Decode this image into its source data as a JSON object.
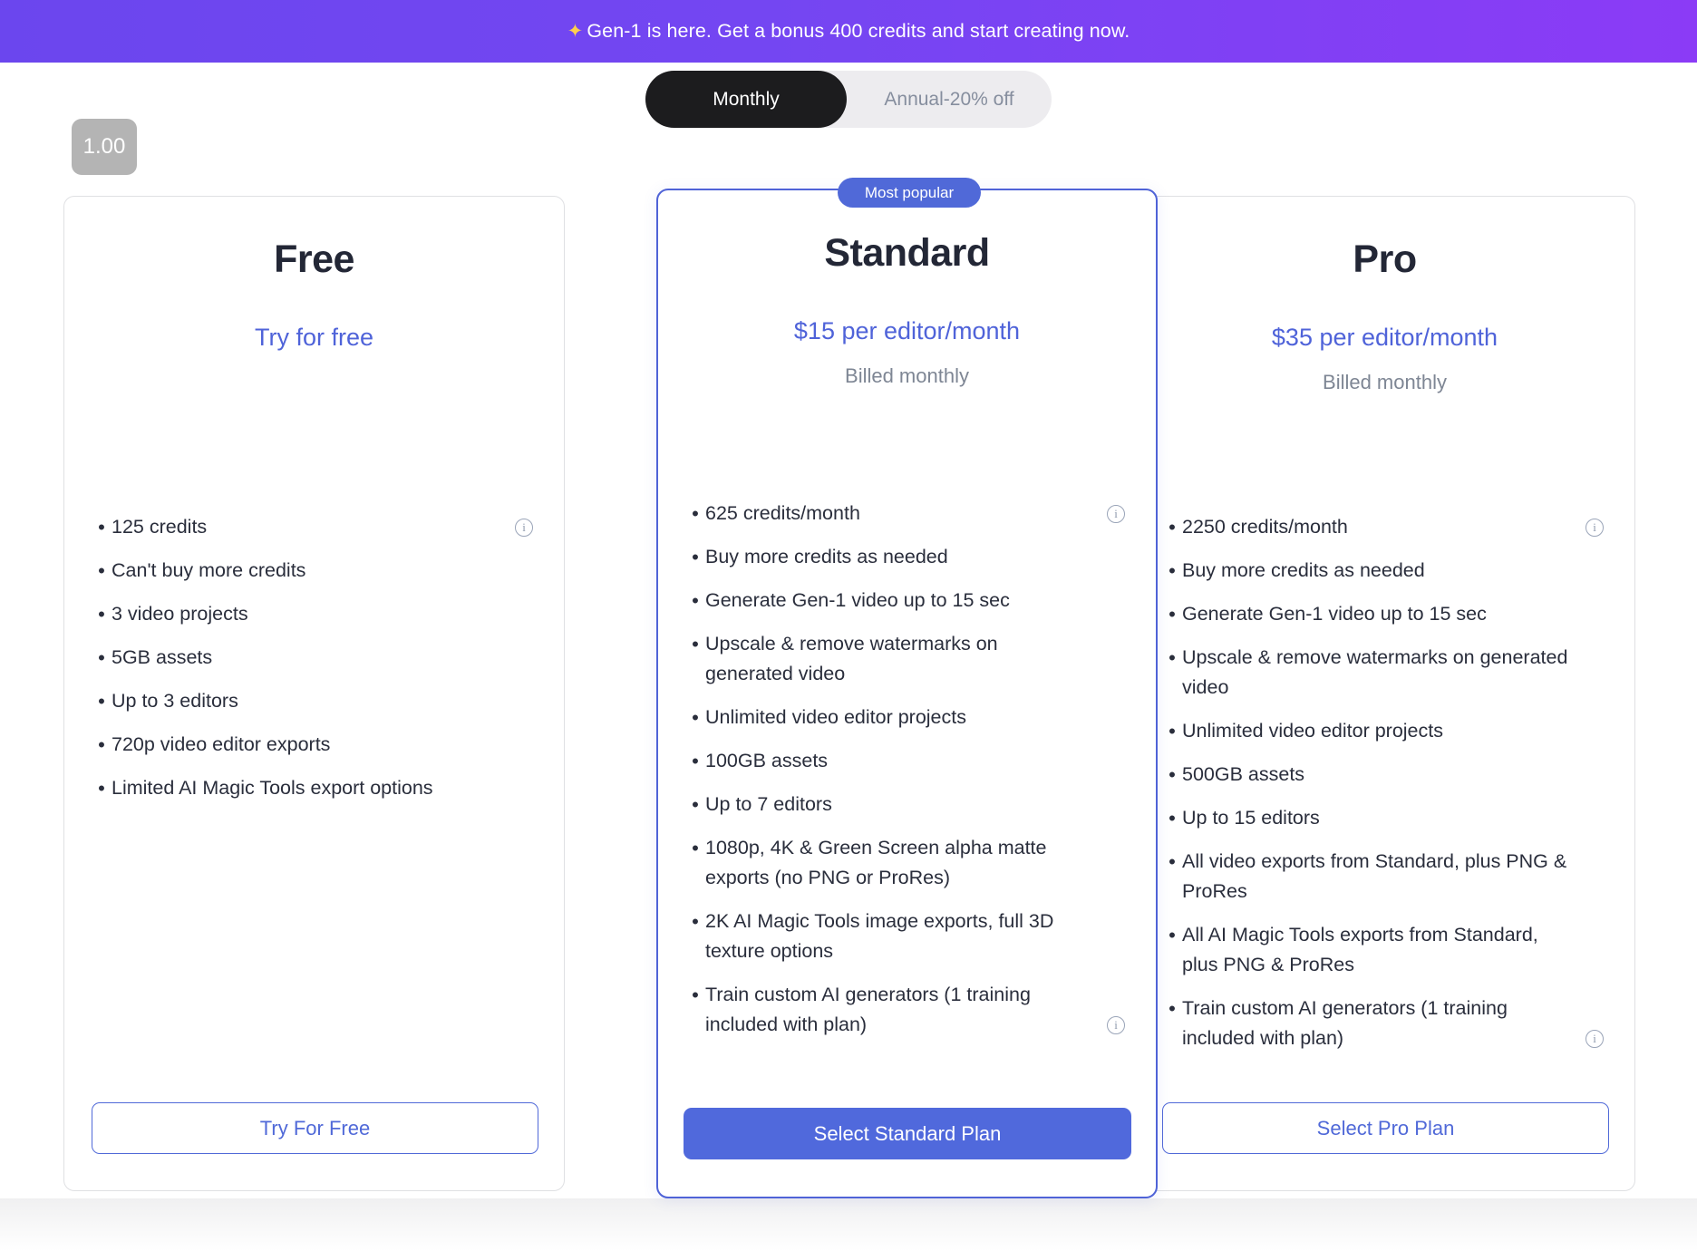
{
  "banner": {
    "icon": "sparkles-icon",
    "icon_glyph": "✦",
    "text": "Gen-1 is here. Get a bonus 400 credits and start creating now.",
    "gradient_from": "#6b46ee",
    "gradient_to": "#8b3bf6"
  },
  "billing_toggle": {
    "options": [
      {
        "label": "Monthly",
        "selected": true
      },
      {
        "label": "Annual-20% off",
        "selected": false
      }
    ],
    "active_bg": "#1c1c1e",
    "track_bg": "#edecef"
  },
  "zoom_indicator": {
    "value": "1.00"
  },
  "accent": {
    "blue": "#5069d8",
    "badge_blue": "#5069d8",
    "text_dark": "#232736",
    "muted": "#7e8694"
  },
  "plans": [
    {
      "name": "Free",
      "price": "Try for free",
      "billing": "",
      "badge": "",
      "highlighted": false,
      "features": [
        {
          "text": "125 credits",
          "info": true
        },
        {
          "text": "Can't buy more credits",
          "info": false
        },
        {
          "text": "3 video projects",
          "info": false
        },
        {
          "text": "5GB assets",
          "info": false
        },
        {
          "text": "Up to 3 editors",
          "info": false
        },
        {
          "text": "720p video editor exports",
          "info": false
        },
        {
          "text": "Limited AI Magic Tools export options",
          "info": false
        }
      ],
      "cta": {
        "label": "Try For Free",
        "style": "outline"
      }
    },
    {
      "name": "Standard",
      "price": "$15 per editor/month",
      "billing": "Billed monthly",
      "badge": "Most popular",
      "highlighted": true,
      "features": [
        {
          "text": "625 credits/month",
          "info": true
        },
        {
          "text": "Buy more credits as needed",
          "info": false
        },
        {
          "text": "Generate Gen-1 video up to 15 sec",
          "info": false
        },
        {
          "text": "Upscale & remove watermarks on generated video",
          "info": false
        },
        {
          "text": "Unlimited video editor projects",
          "info": false
        },
        {
          "text": "100GB assets",
          "info": false
        },
        {
          "text": "Up to 7 editors",
          "info": false
        },
        {
          "text": "1080p, 4K & Green Screen alpha matte exports (no PNG or ProRes)",
          "info": false
        },
        {
          "text": "2K AI Magic Tools image exports, full 3D texture options",
          "info": false
        },
        {
          "text": "Train custom AI generators (1 training included with plan)",
          "info": true
        }
      ],
      "cta": {
        "label": "Select Standard Plan",
        "style": "filled"
      }
    },
    {
      "name": "Pro",
      "price": "$35 per editor/month",
      "billing": "Billed monthly",
      "badge": "",
      "highlighted": false,
      "features": [
        {
          "text": "2250 credits/month",
          "info": true
        },
        {
          "text": "Buy more credits as needed",
          "info": false
        },
        {
          "text": "Generate Gen-1 video up to 15 sec",
          "info": false
        },
        {
          "text": "Upscale & remove watermarks on generated video",
          "info": false
        },
        {
          "text": "Unlimited video editor projects",
          "info": false
        },
        {
          "text": "500GB assets",
          "info": false
        },
        {
          "text": "Up to 15 editors",
          "info": false
        },
        {
          "text": "All video exports from Standard, plus PNG & ProRes",
          "info": false
        },
        {
          "text": "All AI Magic Tools exports from Standard, plus PNG & ProRes",
          "info": false
        },
        {
          "text": "Train custom AI generators (1 training included with plan)",
          "info": true
        }
      ],
      "cta": {
        "label": "Select Pro Plan",
        "style": "outline"
      }
    }
  ]
}
